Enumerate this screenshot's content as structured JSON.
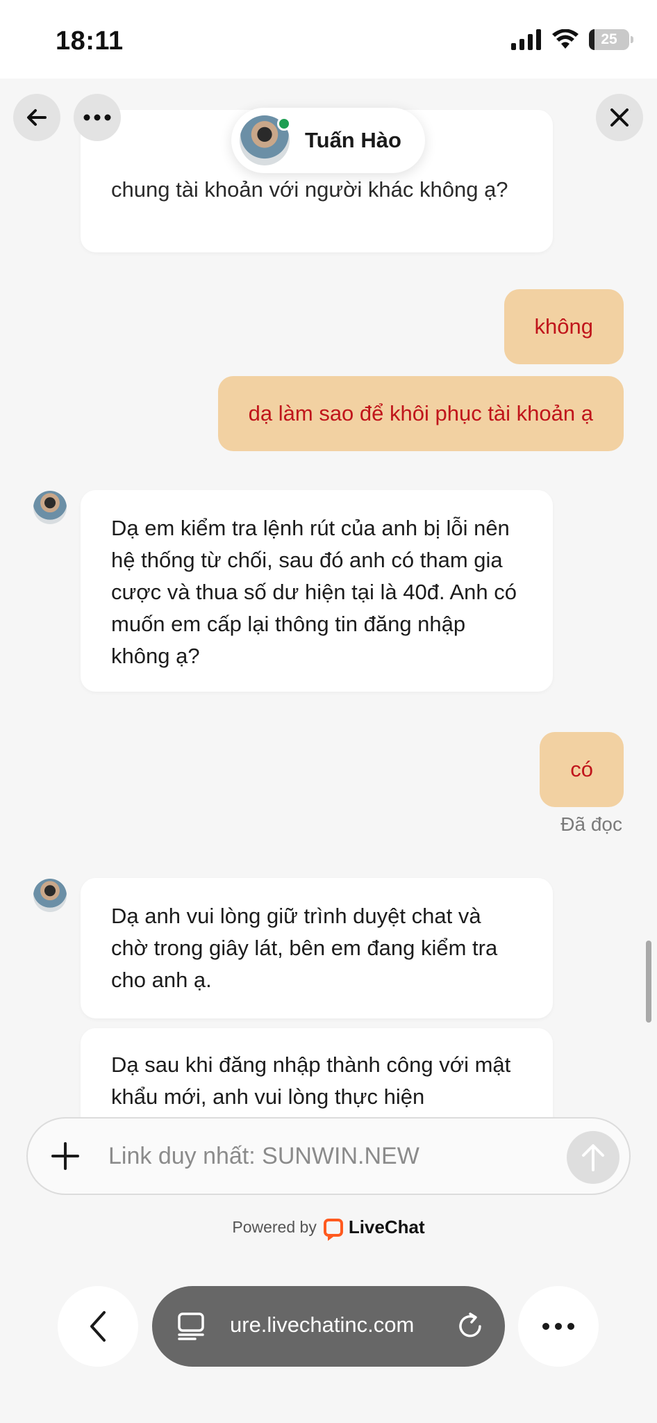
{
  "status_bar": {
    "time": "18:11",
    "battery": "25"
  },
  "chat_header": {
    "agent_name": "Tuấn Hào"
  },
  "messages": {
    "m0_partial": "chung tài khoản với người khác không ạ?",
    "m1": "không",
    "m2": "dạ làm sao để khôi phục tài khoản ạ",
    "m3": "Dạ em kiểm tra lệnh rút của anh bị lỗi nên hệ thống từ chối, sau đó anh có tham gia cược và thua số dư hiện tại là 40đ. Anh có muốn em cấp lại thông tin đăng nhập không ạ?",
    "m4": "có",
    "m4_status": "Đã đọc",
    "m5": "Dạ anh vui lòng giữ trình duyệt chat và chờ trong giây lát, bên em đang kiểm tra cho anh ạ.",
    "m6_partial": "Dạ sau khi đăng nhập thành công với mật khẩu mới, anh vui lòng thực hiện"
  },
  "composer": {
    "placeholder": "Link duy nhất: SUNWIN.NEW"
  },
  "footer": {
    "powered_by": "Powered by",
    "brand": "LiveChat"
  },
  "browser": {
    "url": "ure.livechatinc.com"
  },
  "colors": {
    "outgoing_bubble": "#f2d1a2",
    "outgoing_text": "#c0151b",
    "online": "#1e9e52",
    "livechat": "#ff5a1f"
  }
}
